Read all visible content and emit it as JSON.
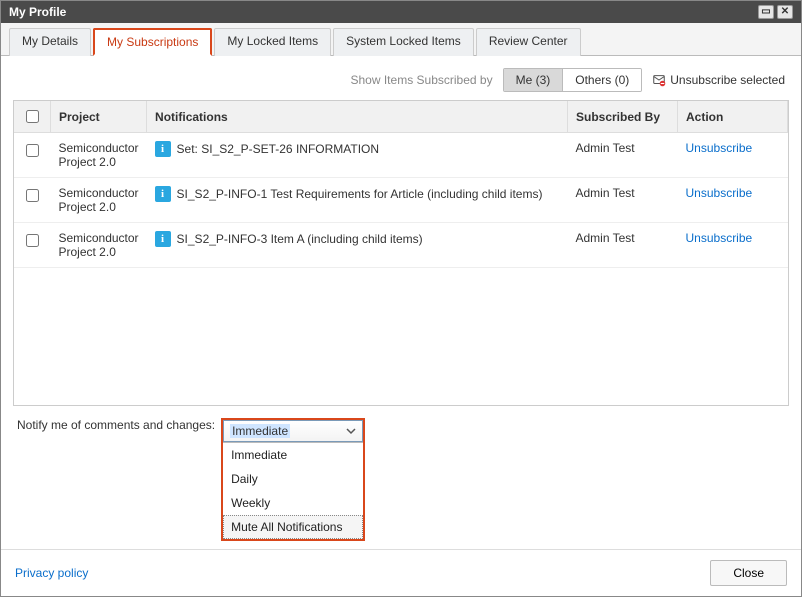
{
  "window": {
    "title": "My Profile"
  },
  "tabs": [
    {
      "label": "My Details",
      "active": false
    },
    {
      "label": "My Subscriptions",
      "active": true
    },
    {
      "label": "My Locked Items",
      "active": false
    },
    {
      "label": "System Locked Items",
      "active": false
    },
    {
      "label": "Review Center",
      "active": false
    }
  ],
  "filter": {
    "label": "Show Items Subscribed by",
    "me_label": "Me (3)",
    "others_label": "Others (0)",
    "unsubscribe_selected": "Unsubscribe selected"
  },
  "columns": {
    "project": "Project",
    "notifications": "Notifications",
    "subscribed_by": "Subscribed By",
    "action": "Action"
  },
  "rows": [
    {
      "project": "Semiconductor Project 2.0",
      "notification": "Set: SI_S2_P-SET-26 INFORMATION",
      "subscribed_by": "Admin Test",
      "action": "Unsubscribe"
    },
    {
      "project": "Semiconductor Project 2.0",
      "notification": "SI_S2_P-INFO-1 Test Requirements for Article (including child items)",
      "subscribed_by": "Admin Test",
      "action": "Unsubscribe"
    },
    {
      "project": "Semiconductor Project 2.0",
      "notification": "SI_S2_P-INFO-3 Item A (including child items)",
      "subscribed_by": "Admin Test",
      "action": "Unsubscribe"
    }
  ],
  "notify": {
    "label": "Notify me of comments and changes:",
    "selected": "Immediate",
    "options": [
      "Immediate",
      "Daily",
      "Weekly",
      "Mute All Notifications"
    ]
  },
  "footer": {
    "privacy": "Privacy policy",
    "close": "Close"
  }
}
